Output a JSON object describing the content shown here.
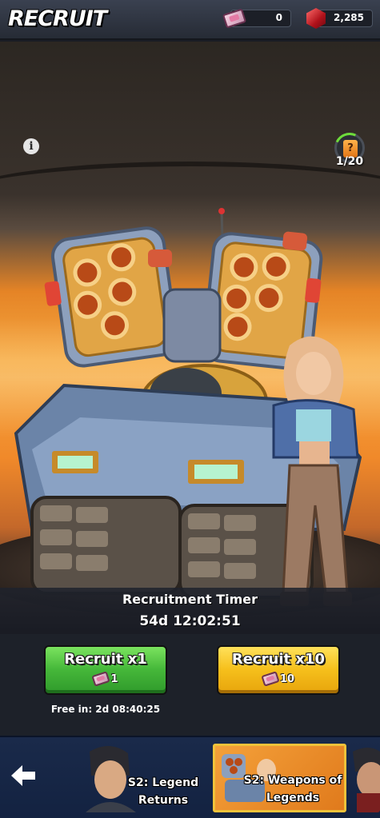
{
  "header": {
    "title": "RECRUIT",
    "tickets": "0",
    "gems": "2,285"
  },
  "scene": {
    "pity_counter": "1/20",
    "pity_icon_glyph": "?"
  },
  "timer": {
    "label": "Recruitment Timer",
    "value": "54d 12:02:51"
  },
  "actions": {
    "recruit_x1": {
      "label": "Recruit x1",
      "cost": "1"
    },
    "recruit_x10": {
      "label": "Recruit x10",
      "cost": "10"
    },
    "free_in": "Free in: 2d 08:40:25"
  },
  "banners": [
    {
      "line1": "S2: Legend",
      "line2": "Returns"
    },
    {
      "line1": "S2: Weapons of",
      "line2": "Legends"
    }
  ],
  "colors": {
    "recruit_x1": "#46b83a",
    "recruit_x10": "#f6c01c",
    "selected_banner_border": "#f0c23a",
    "gem": "#d8222b"
  },
  "icons": [
    "ticket-icon",
    "gem-icon",
    "info-icon",
    "book-icon",
    "back-arrow-icon"
  ]
}
